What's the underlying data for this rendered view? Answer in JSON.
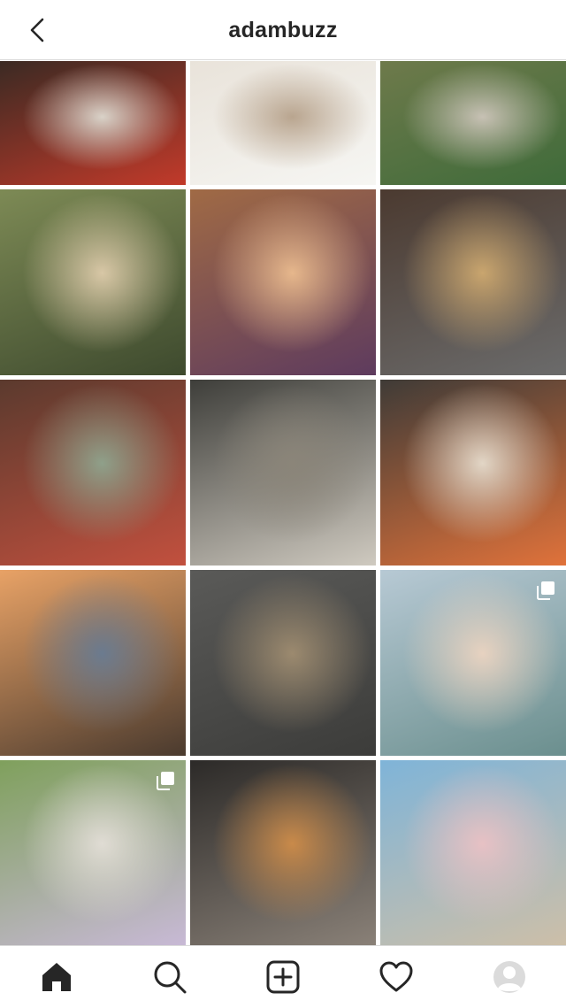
{
  "header": {
    "username": "adambuzz",
    "back_icon": "chevron-left-icon"
  },
  "grid": {
    "posts": [
      {
        "name": "post-clown-chair",
        "colors": [
          "#3b2a23",
          "#d9d2c8",
          "#c23a2a"
        ],
        "multi": false
      },
      {
        "name": "post-girl-duck",
        "colors": [
          "#e9e3da",
          "#b9a58f",
          "#f6f6f3"
        ],
        "multi": false
      },
      {
        "name": "post-kids-creek",
        "colors": [
          "#6e7a4b",
          "#c7c1b4",
          "#3f6b3a"
        ],
        "multi": false
      },
      {
        "name": "post-girls-pond",
        "colors": [
          "#7d8a55",
          "#d8c7a6",
          "#3e4a2e"
        ],
        "multi": false
      },
      {
        "name": "post-girl-cap-smile",
        "colors": [
          "#a06a45",
          "#e6b78c",
          "#5e3b5e"
        ],
        "multi": false
      },
      {
        "name": "post-the-end-sign",
        "colors": [
          "#4b3a30",
          "#c9a56e",
          "#6b6b6b"
        ],
        "multi": false
      },
      {
        "name": "post-kids-flowers",
        "colors": [
          "#5b3a2e",
          "#8fa08a",
          "#c2503e"
        ],
        "multi": false
      },
      {
        "name": "post-selfie-rv",
        "colors": [
          "#3e3e3a",
          "#8b8579",
          "#cfcac0"
        ],
        "multi": false
      },
      {
        "name": "post-girl-burger",
        "colors": [
          "#3f3b37",
          "#e2d6c6",
          "#e0723a"
        ],
        "multi": false
      },
      {
        "name": "post-playground-sunset",
        "colors": [
          "#e8a266",
          "#6b7b8f",
          "#4a3a2e"
        ],
        "multi": false
      },
      {
        "name": "post-boxes-heads",
        "colors": [
          "#5a5a58",
          "#9c8a6f",
          "#3c3c3a"
        ],
        "multi": false
      },
      {
        "name": "post-dad-daughter-beach",
        "colors": [
          "#b7c9d4",
          "#e7d2c0",
          "#6b8f8e"
        ],
        "multi": true
      },
      {
        "name": "post-bike-ride",
        "colors": [
          "#7fa05c",
          "#e0dcd4",
          "#c8b9d6"
        ],
        "multi": true
      },
      {
        "name": "post-selfie-buggy",
        "colors": [
          "#2c2a28",
          "#c98a4a",
          "#8a8178"
        ],
        "multi": false
      },
      {
        "name": "post-family-beach",
        "colors": [
          "#7fb4d8",
          "#e7c1c4",
          "#cdbfa8"
        ],
        "multi": false
      }
    ]
  },
  "tabbar": {
    "tabs": [
      {
        "name": "tab-home",
        "icon": "home-icon"
      },
      {
        "name": "tab-search",
        "icon": "search-icon"
      },
      {
        "name": "tab-new-post",
        "icon": "plus-square-icon"
      },
      {
        "name": "tab-activity",
        "icon": "heart-icon"
      },
      {
        "name": "tab-profile",
        "icon": "avatar-icon"
      }
    ]
  }
}
